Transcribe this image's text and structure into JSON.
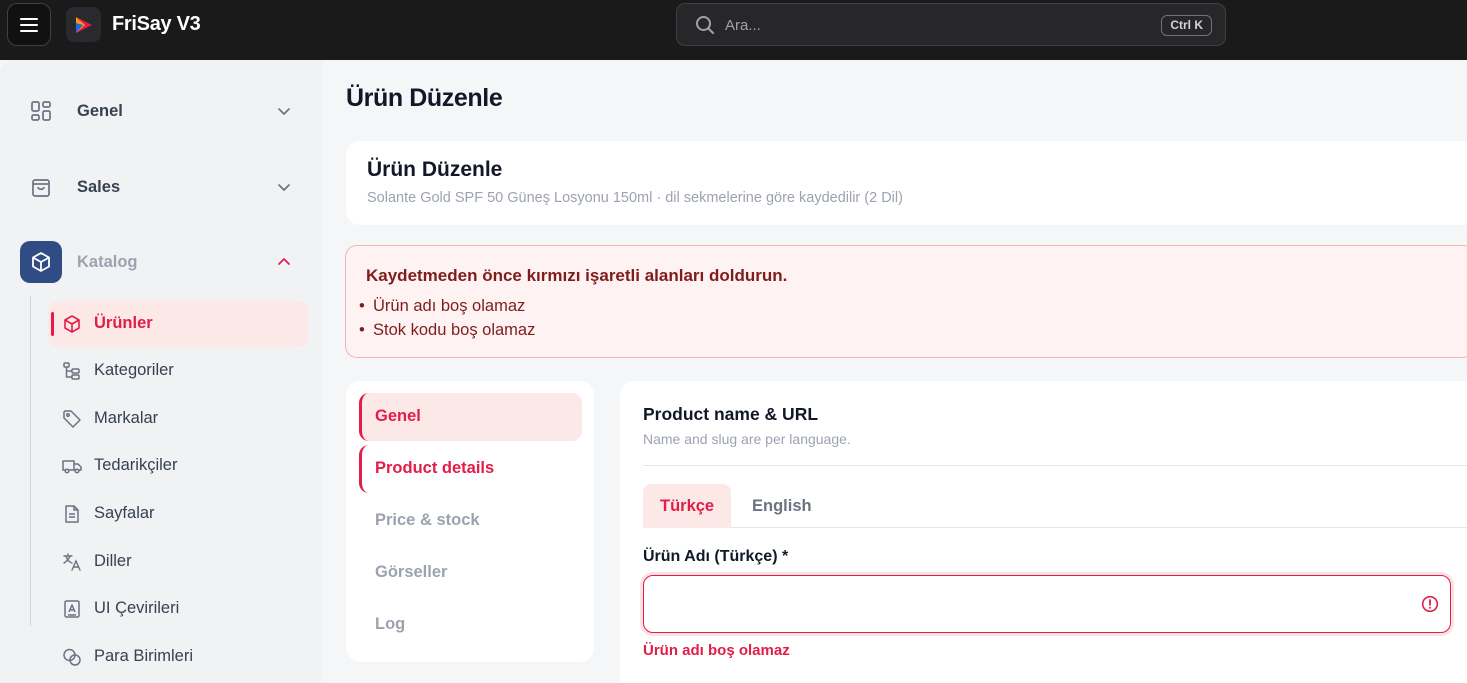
{
  "app": {
    "title": "FriSay V3"
  },
  "search": {
    "placeholder": "Ara...",
    "shortcut": "Ctrl K"
  },
  "sidebar": {
    "groups": [
      {
        "label": "Genel",
        "icon": "grid-icon",
        "expanded": false
      },
      {
        "label": "Sales",
        "icon": "shopping-bag-icon",
        "expanded": false
      },
      {
        "label": "Katalog",
        "icon": "box-icon",
        "expanded": true
      }
    ],
    "items": [
      {
        "label": "Ürünler",
        "icon": "box-icon",
        "active": true
      },
      {
        "label": "Kategoriler",
        "icon": "tree-icon"
      },
      {
        "label": "Markalar",
        "icon": "tag-icon"
      },
      {
        "label": "Tedarikçiler",
        "icon": "truck-icon"
      },
      {
        "label": "Sayfalar",
        "icon": "file-icon"
      },
      {
        "label": "Diller",
        "icon": "translate-icon"
      },
      {
        "label": "UI Çevirileri",
        "icon": "file-text-icon"
      },
      {
        "label": "Para Birimleri",
        "icon": "coins-icon"
      }
    ]
  },
  "page": {
    "title": "Ürün Düzenle",
    "header": {
      "title": "Ürün Düzenle",
      "subtitle": "Solante Gold SPF 50 Güneş Losyonu 150ml · dil sekmelerine göre kaydedilir (2 Dil)"
    },
    "alert": {
      "title": "Kaydetmeden önce kırmızı işaretli alanları doldurun.",
      "items": [
        "Ürün adı boş olamaz",
        "Stok kodu boş olamaz"
      ]
    },
    "section_tabs": [
      {
        "label": "Genel",
        "state": "active"
      },
      {
        "label": "Product details",
        "state": "error"
      },
      {
        "label": "Price & stock",
        "state": "normal"
      },
      {
        "label": "Görseller",
        "state": "normal"
      },
      {
        "label": "Log",
        "state": "normal"
      }
    ],
    "form": {
      "title": "Product name & URL",
      "subtitle": "Name and slug are per language.",
      "lang_tabs": [
        {
          "label": "Türkçe",
          "active": true
        },
        {
          "label": "English",
          "active": false
        }
      ],
      "name_label": "Ürün Adı (Türkçe) *",
      "name_value": "",
      "name_error": "Ürün adı boş olamaz"
    }
  },
  "colors": {
    "accent": "#e11d48",
    "active_group": "#2f4d84",
    "topbar": "#1a1a1a",
    "alert_bg": "#fef2f2"
  }
}
